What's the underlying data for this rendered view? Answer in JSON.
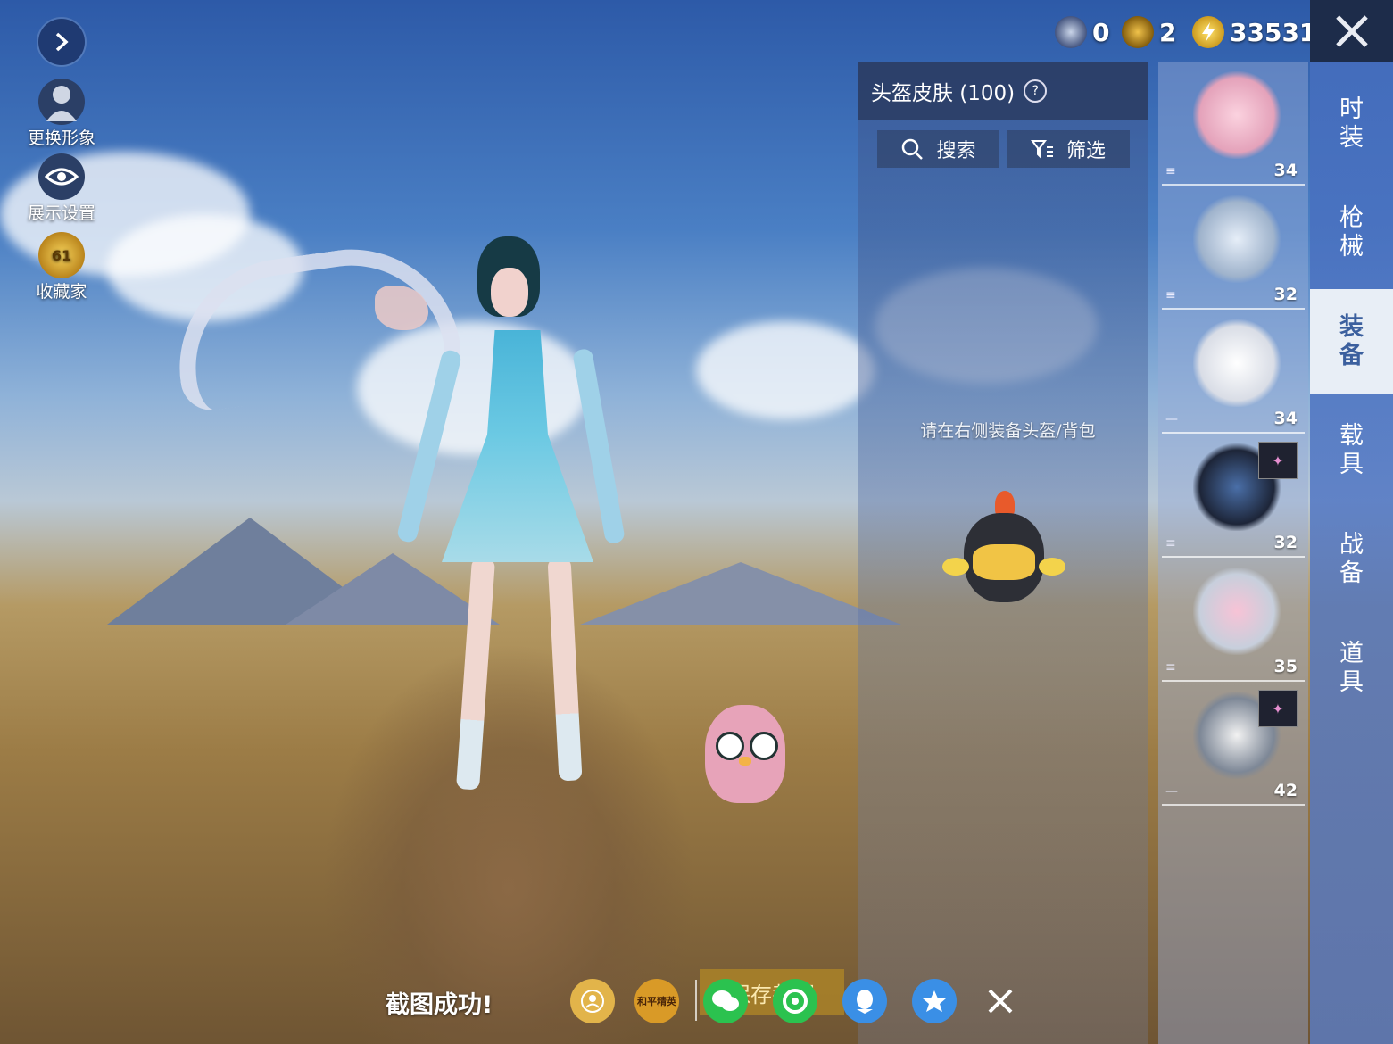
{
  "resources": [
    {
      "icon": "medal-coin-icon",
      "value": "0"
    },
    {
      "icon": "badge-coin-icon",
      "value": "2"
    },
    {
      "icon": "lightning-coin-icon",
      "value": "33531"
    }
  ],
  "left_menu": [
    {
      "label": "更换形象",
      "icon": "avatar-icon"
    },
    {
      "label": "展示设置",
      "icon": "eye-icon"
    },
    {
      "label": "收藏家",
      "icon": "collector-badge-icon",
      "badge": "61"
    }
  ],
  "panel": {
    "title": "头盔皮肤 (100)",
    "search_label": "搜索",
    "filter_label": "筛选",
    "hint": "请在右侧装备头盔/背包"
  },
  "tabs": [
    {
      "label": "时\n装",
      "active": false
    },
    {
      "label": "枪\n械",
      "active": false
    },
    {
      "label": "装\n备",
      "active": true
    },
    {
      "label": "载\n具",
      "active": false
    },
    {
      "label": "战\n备",
      "active": false
    },
    {
      "label": "道\n具",
      "active": false
    }
  ],
  "items": [
    {
      "level": "34",
      "icon": "cake-helmet-icon",
      "grip": "≡"
    },
    {
      "level": "32",
      "icon": "dragon-helmet-icon",
      "grip": "≡"
    },
    {
      "level": "34",
      "icon": "white-helmet-icon",
      "grip": "—"
    },
    {
      "level": "32",
      "icon": "rabbit-backpack-icon",
      "grip": "≡",
      "tag": true
    },
    {
      "level": "35",
      "icon": "bow-backpack-icon",
      "grip": "≡"
    },
    {
      "level": "42",
      "icon": "pendant-backpack-icon",
      "grip": "—",
      "tag": true
    }
  ],
  "bottom": {
    "toast": "截图成功!",
    "save_label": "保存截图",
    "share_targets": [
      "profile-share-icon",
      "game-logo-icon",
      "wechat-icon",
      "moments-icon",
      "qq-icon",
      "qzone-icon",
      "close-icon"
    ],
    "game_logo_text": "和平精英"
  },
  "colors": {
    "active_tab_bg": "#e8eef6",
    "tab_strip": "#4a6ec0",
    "gold": "#d8a829"
  }
}
